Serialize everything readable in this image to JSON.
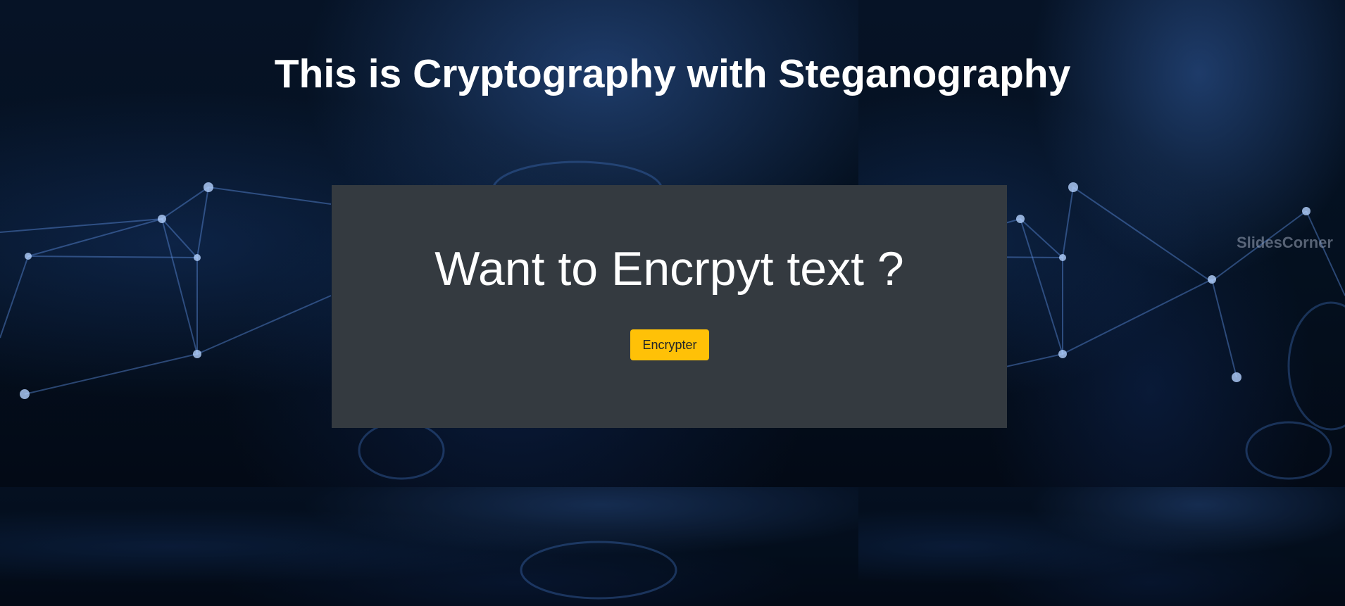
{
  "page": {
    "title": "This is Cryptography with Steganography"
  },
  "card": {
    "heading": "Want to Encrpyt text ?",
    "button_label": "Encrypter"
  },
  "background": {
    "watermark": "SlidesCorner"
  },
  "colors": {
    "card_bg": "#343a40",
    "button_bg": "#ffc107",
    "page_bg": "#030a16"
  }
}
